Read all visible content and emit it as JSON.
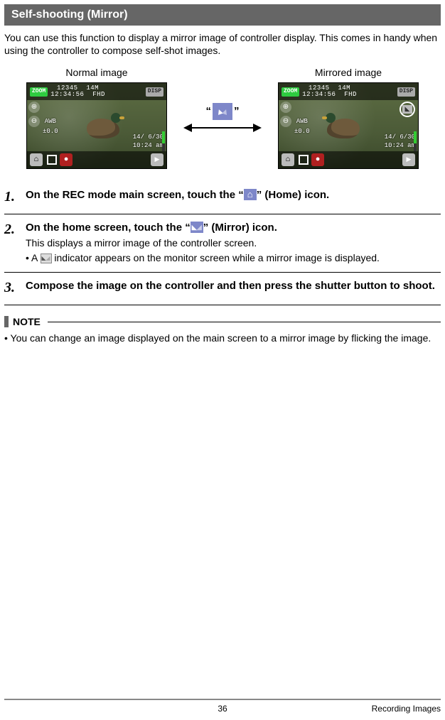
{
  "section_title": "Self-shooting (Mirror)",
  "intro": "You can use this function to display a mirror image of controller display. This comes in handy when using the controller to compose self-shot images.",
  "images": {
    "normal_label": "Normal image",
    "mirrored_label": "Mirrored image",
    "icon_quoted_left": "“",
    "icon_quoted_right": "”"
  },
  "lcd": {
    "zoom": "ZOOM",
    "disp": "DISP",
    "counter": "12345",
    "res": "14M",
    "time": "12:34:56",
    "vid": "FHD",
    "awb": "AWB",
    "ev": "±0.0",
    "date": "14/ 6/30",
    "clock": "10:24 am"
  },
  "steps": [
    {
      "num": "1.",
      "title_pre": "On the REC mode main screen, touch the “",
      "title_post": "” (Home) icon."
    },
    {
      "num": "2.",
      "title_pre": "On the home screen, touch the “",
      "title_post": "” (Mirror) icon.",
      "sub1": "This displays a mirror image of the controller screen.",
      "sub2_pre": "A ",
      "sub2_post": " indicator appears on the monitor screen while a mirror image is displayed."
    },
    {
      "num": "3.",
      "title": "Compose the image on the controller and then press the shutter button to shoot."
    }
  ],
  "note": {
    "label": "NOTE",
    "text": "You can change an image displayed on the main screen to a mirror image by flicking the image."
  },
  "footer": {
    "page": "36",
    "section": "Recording Images"
  }
}
